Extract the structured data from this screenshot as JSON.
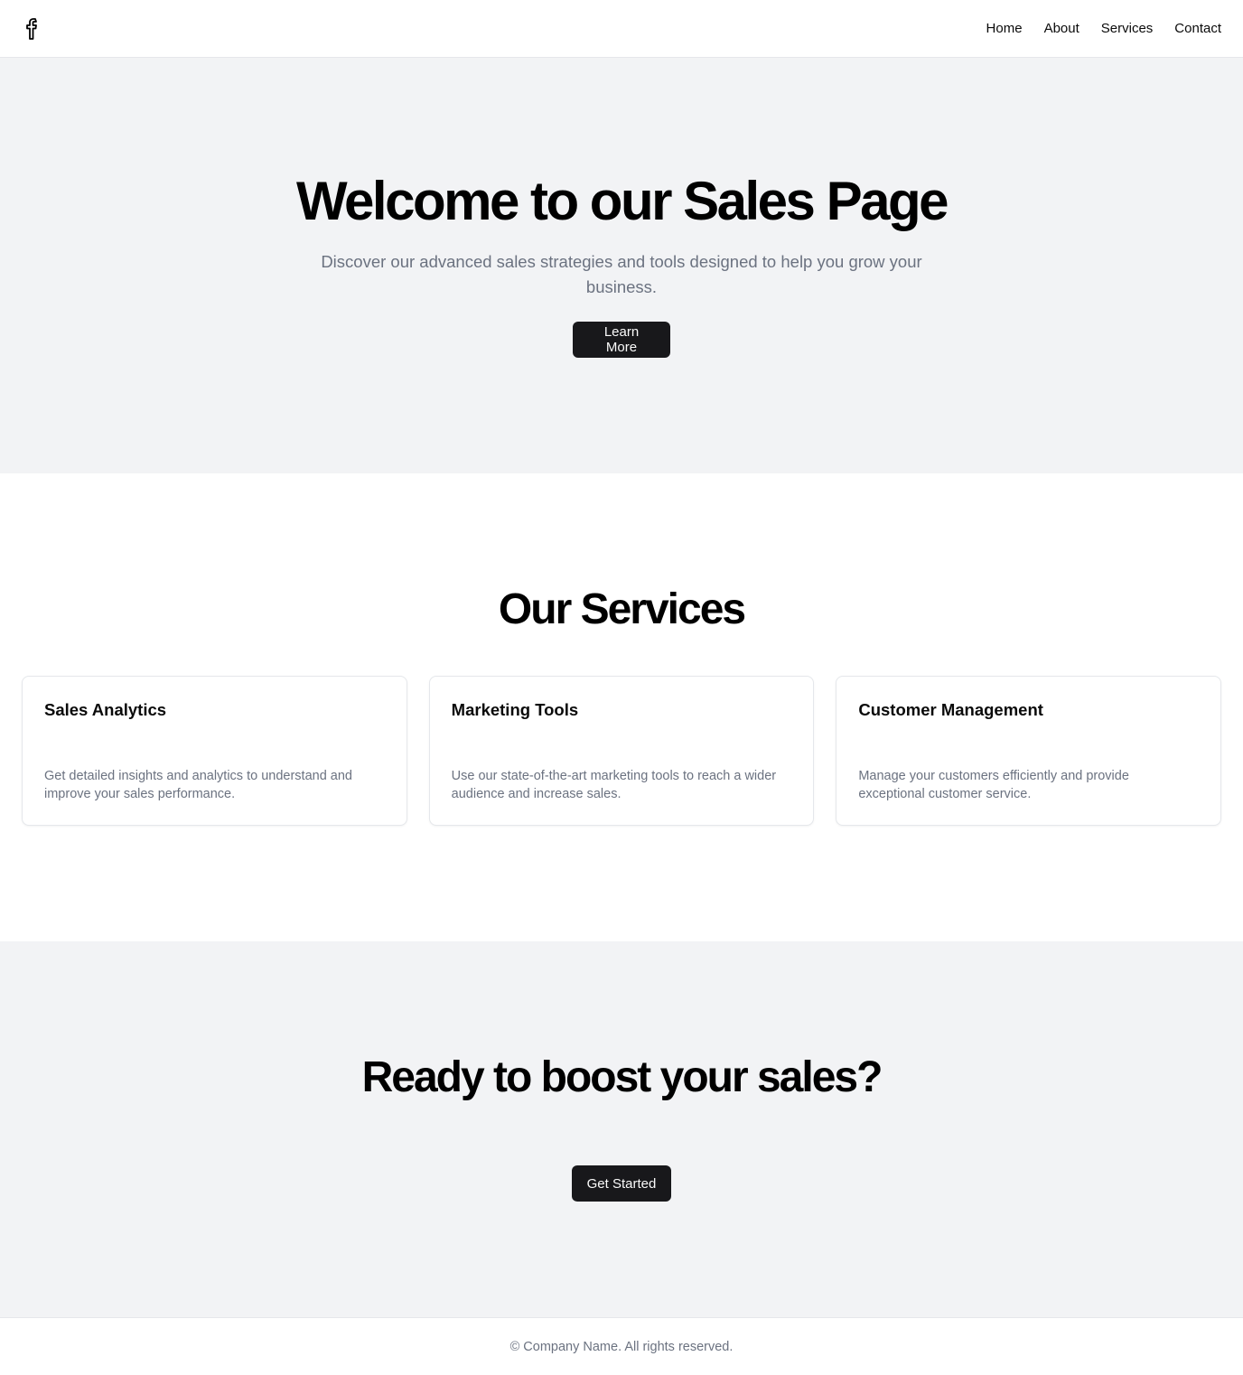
{
  "header": {
    "logo_icon": "facebook-icon",
    "nav": [
      {
        "label": "Home"
      },
      {
        "label": "About"
      },
      {
        "label": "Services"
      },
      {
        "label": "Contact"
      }
    ]
  },
  "hero": {
    "title": "Welcome to our Sales Page",
    "subtitle": "Discover our advanced sales strategies and tools designed to help you grow your business.",
    "button_label": "Learn More"
  },
  "services": {
    "heading": "Our Services",
    "cards": [
      {
        "title": "Sales Analytics",
        "description": "Get detailed insights and analytics to understand and improve your sales performance."
      },
      {
        "title": "Marketing Tools",
        "description": "Use our state-of-the-art marketing tools to reach a wider audience and increase sales."
      },
      {
        "title": "Customer Management",
        "description": "Manage your customers efficiently and provide exceptional customer service."
      }
    ]
  },
  "cta": {
    "heading": "Ready to boost your sales?",
    "button_label": "Get Started"
  },
  "footer": {
    "text": "© Company Name. All rights reserved."
  },
  "colors": {
    "primary_button": "#18181b",
    "section_gray": "#f2f3f5",
    "muted_text": "#6b7280"
  }
}
